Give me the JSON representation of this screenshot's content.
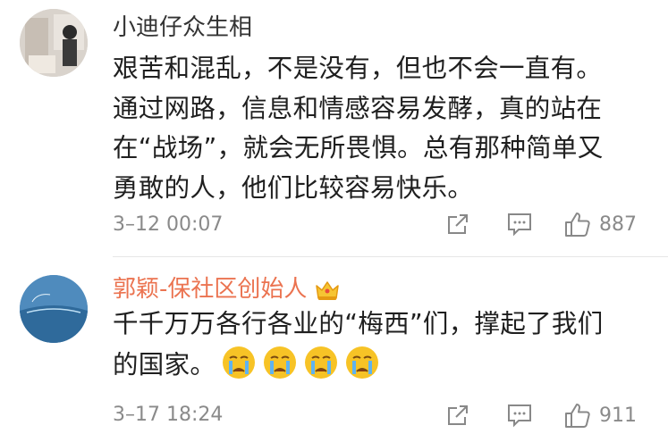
{
  "comments": [
    {
      "username": "小迪仔众生相",
      "text": "艰苦和混乱，不是没有，但也不会一直有。\n通过网路，信息和情感容易发酵，真的站在\n在“战场”，就会无所畏惧。总有那种简单又\n勇敢的人，他们比较容易快乐。",
      "time": "3–12 00:07",
      "likes": "887",
      "avatar": "avatar-photo",
      "name_color": "#333333"
    },
    {
      "username": "郭颖-保社区创始人",
      "text": "千千万万各行各业的“梅西”们，撑起了我们\n的国家。",
      "emoji": [
        "crying-face-icon",
        "crying-face-icon",
        "crying-face-icon",
        "crying-face-icon"
      ],
      "time": "3–17 18:24",
      "likes": "911",
      "avatar": "avatar-photo",
      "badge": "vip-crown-icon",
      "name_color": "#eb7350"
    }
  ],
  "icons": {
    "forward": "forward-icon",
    "reply": "reply-icon",
    "like": "thumbs-up-icon"
  },
  "colors": {
    "accent_name": "#eb7350",
    "meta_gray": "#8a8a8a",
    "icon_gray": "#888888"
  }
}
